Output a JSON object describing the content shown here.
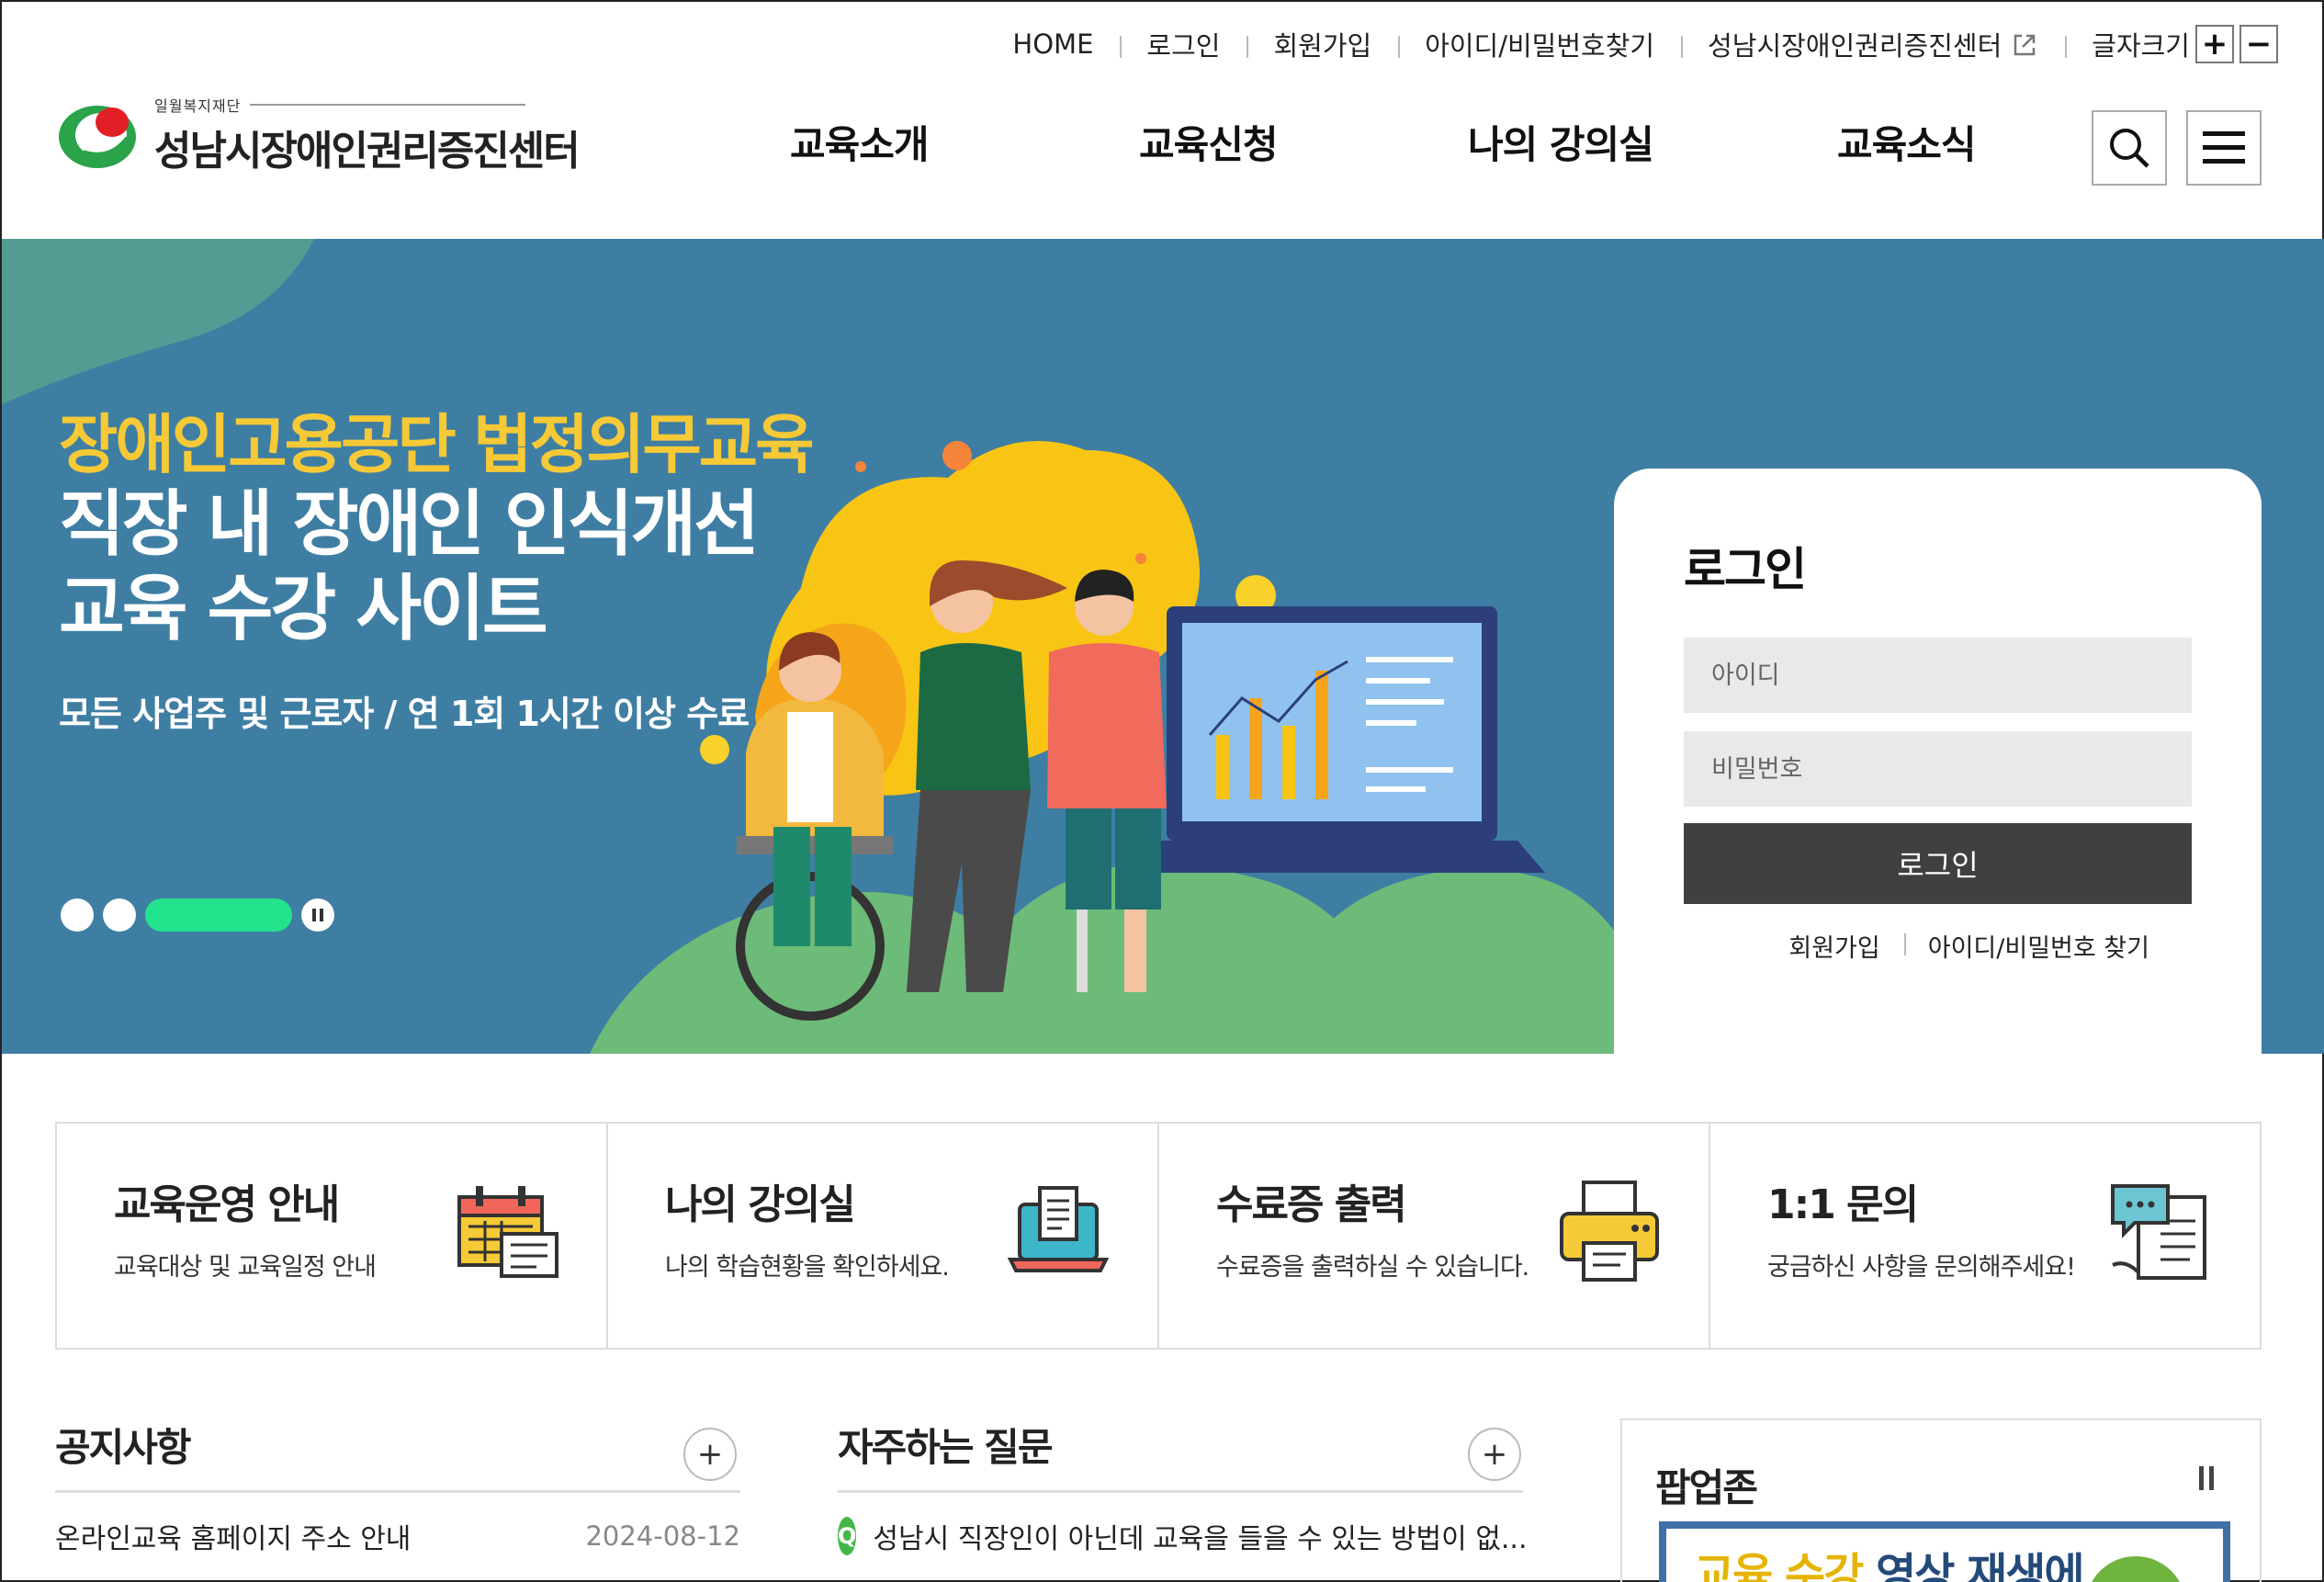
{
  "utility_nav": {
    "items": [
      "HOME",
      "로그인",
      "회원가입",
      "아이디/비밀번호찾기",
      "성남시장애인권리증진센터"
    ],
    "font_size_label": "글자크기",
    "plus": "+",
    "minus": "−"
  },
  "logo": {
    "subtitle": "일월복지재단",
    "title": "성남시장애인권리증진센터"
  },
  "main_nav": {
    "items": [
      "교육소개",
      "교육신청",
      "나의 강의실",
      "교육소식"
    ]
  },
  "hero": {
    "eyebrow": "장애인고용공단 법정의무교육",
    "title_line1": "직장 내 장애인 인식개선",
    "title_line2": "교육 수강 사이트",
    "subtitle": "모든 사업주 및 근로자  /  연 1회 1시간 이상 수료",
    "slide_count": 3,
    "active_slide": 3
  },
  "login": {
    "title": "로그인",
    "id_placeholder": "아이디",
    "pw_placeholder": "비밀번호",
    "button": "로그인",
    "links": [
      "회원가입",
      "아이디/비밀번호 찾기"
    ]
  },
  "quick_menu": [
    {
      "title": "교육운영 안내",
      "desc": "교육대상 및 교육일정 안내",
      "icon": "calendar-icon"
    },
    {
      "title": "나의 강의실",
      "desc": "나의 학습현황을 확인하세요.",
      "icon": "laptop-document-icon"
    },
    {
      "title": "수료증 출력",
      "desc": "수료증을 출력하실 수 있습니다.",
      "icon": "printer-icon"
    },
    {
      "title": "1:1 문의",
      "desc": "궁금하신 사항을 문의해주세요!",
      "icon": "chat-inquiry-icon"
    }
  ],
  "notice": {
    "title": "공지사항",
    "more": "+",
    "items": [
      {
        "title": "온라인교육 홈페이지 주소 안내",
        "date": "2024-08-12"
      }
    ]
  },
  "faq": {
    "title": "자주하는 질문",
    "more": "+",
    "q_label": "Q",
    "items": [
      "성남시 직장인이 아닌데 교육을 들을 수 있는 방법이 없..."
    ]
  },
  "popup_zone": {
    "title": "팝업존",
    "banner_yellow": "교육 수강",
    "banner_dark": " 영상 재생에"
  },
  "colors": {
    "hero_bg": "#3f7ea3",
    "accent_yellow": "#f6c936",
    "slider_active": "#22e38b",
    "login_button": "#404040",
    "faq_badge": "#43b649"
  }
}
